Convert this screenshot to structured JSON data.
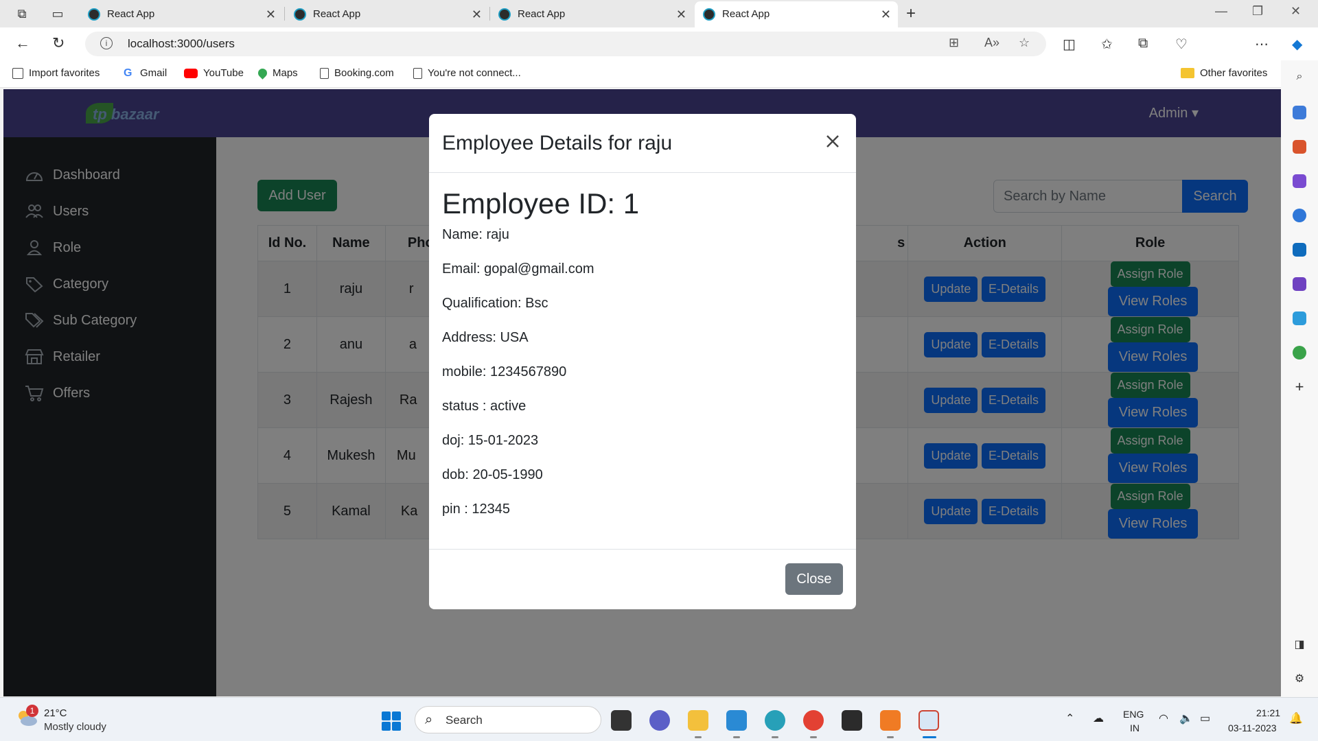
{
  "browser": {
    "tabs": [
      {
        "label": "React App"
      },
      {
        "label": "React App"
      },
      {
        "label": "React App"
      },
      {
        "label": "React App"
      }
    ],
    "url": "localhost:3000/users",
    "favorites": [
      {
        "label": "Import favorites",
        "icon": "import-icon"
      },
      {
        "label": "Gmail",
        "icon": "google-icon"
      },
      {
        "label": "YouTube",
        "icon": "youtube-icon"
      },
      {
        "label": "Maps",
        "icon": "maps-pin-icon"
      },
      {
        "label": "Booking.com",
        "icon": "page-icon"
      },
      {
        "label": "You're not connect...",
        "icon": "page-icon"
      }
    ],
    "other_favorites": "Other favorites"
  },
  "app": {
    "admin_label": "Admin ▾",
    "sidebar": [
      {
        "label": "Dashboard",
        "icon": "speedometer-icon"
      },
      {
        "label": "Users",
        "icon": "users-icon"
      },
      {
        "label": "Role",
        "icon": "person-icon"
      },
      {
        "label": "Category",
        "icon": "tag-icon"
      },
      {
        "label": "Sub Category",
        "icon": "tags-icon"
      },
      {
        "label": "Retailer",
        "icon": "shop-icon"
      },
      {
        "label": "Offers",
        "icon": "cart-icon"
      }
    ],
    "add_user": "Add User",
    "search_placeholder": "Search by Name",
    "search_button": "Search",
    "table": {
      "headers": [
        "Id No.",
        "Name",
        "Pho",
        "s",
        "Action",
        "Role"
      ],
      "rows": [
        {
          "id": "1",
          "name": "raju",
          "photo_alt": "r"
        },
        {
          "id": "2",
          "name": "anu",
          "photo_alt": "a"
        },
        {
          "id": "3",
          "name": "Rajesh",
          "photo_alt": "Ra"
        },
        {
          "id": "4",
          "name": "Mukesh",
          "photo_alt": "Mu"
        },
        {
          "id": "5",
          "name": "Kamal",
          "photo_alt": "Ka"
        }
      ],
      "update_label": "Update",
      "edetails_label": "E-Details",
      "assign_role_label": "Assign Role",
      "view_roles_label": "View Roles"
    }
  },
  "modal": {
    "title": "Employee Details for raju",
    "employee_id": "Employee ID: 1",
    "details": [
      "Name: raju",
      "Email: gopal@gmail.com",
      "Qualification: Bsc",
      "Address: USA",
      "mobile: 1234567890",
      "status : active",
      "doj: 15-01-2023",
      "dob: 20-05-1990",
      "pin : 12345"
    ],
    "close_label": "Close"
  },
  "taskbar": {
    "weather_badge": "1",
    "temperature": "21°C",
    "condition": "Mostly cloudy",
    "search_label": "Search",
    "lang_top": "ENG",
    "lang_bottom": "IN",
    "time": "21:21",
    "date": "03-11-2023"
  },
  "colors": {
    "navbar": "#4b4593",
    "sidebar": "#212529",
    "primary": "#0d6efd",
    "success": "#198754",
    "secondary": "#6c757d"
  }
}
